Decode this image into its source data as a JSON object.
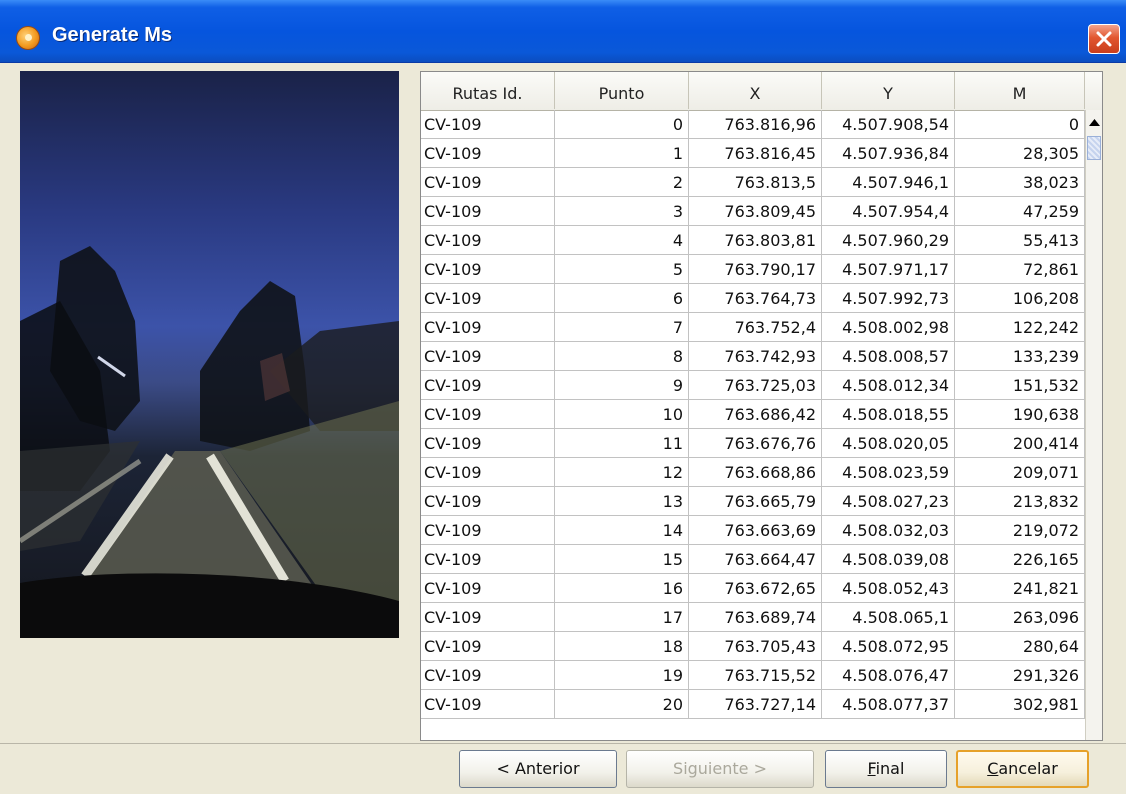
{
  "window": {
    "title": "Generate Ms"
  },
  "table": {
    "columns": [
      "Rutas Id.",
      "Punto",
      "X",
      "Y",
      "M"
    ],
    "rows": [
      [
        "CV-109",
        "0",
        "763.816,96",
        "4.507.908,54",
        "0"
      ],
      [
        "CV-109",
        "1",
        "763.816,45",
        "4.507.936,84",
        "28,305"
      ],
      [
        "CV-109",
        "2",
        "763.813,5",
        "4.507.946,1",
        "38,023"
      ],
      [
        "CV-109",
        "3",
        "763.809,45",
        "4.507.954,4",
        "47,259"
      ],
      [
        "CV-109",
        "4",
        "763.803,81",
        "4.507.960,29",
        "55,413"
      ],
      [
        "CV-109",
        "5",
        "763.790,17",
        "4.507.971,17",
        "72,861"
      ],
      [
        "CV-109",
        "6",
        "763.764,73",
        "4.507.992,73",
        "106,208"
      ],
      [
        "CV-109",
        "7",
        "763.752,4",
        "4.508.002,98",
        "122,242"
      ],
      [
        "CV-109",
        "8",
        "763.742,93",
        "4.508.008,57",
        "133,239"
      ],
      [
        "CV-109",
        "9",
        "763.725,03",
        "4.508.012,34",
        "151,532"
      ],
      [
        "CV-109",
        "10",
        "763.686,42",
        "4.508.018,55",
        "190,638"
      ],
      [
        "CV-109",
        "11",
        "763.676,76",
        "4.508.020,05",
        "200,414"
      ],
      [
        "CV-109",
        "12",
        "763.668,86",
        "4.508.023,59",
        "209,071"
      ],
      [
        "CV-109",
        "13",
        "763.665,79",
        "4.508.027,23",
        "213,832"
      ],
      [
        "CV-109",
        "14",
        "763.663,69",
        "4.508.032,03",
        "219,072"
      ],
      [
        "CV-109",
        "15",
        "763.664,47",
        "4.508.039,08",
        "226,165"
      ],
      [
        "CV-109",
        "16",
        "763.672,65",
        "4.508.052,43",
        "241,821"
      ],
      [
        "CV-109",
        "17",
        "763.689,74",
        "4.508.065,1",
        "263,096"
      ],
      [
        "CV-109",
        "18",
        "763.705,43",
        "4.508.072,95",
        "280,64"
      ],
      [
        "CV-109",
        "19",
        "763.715,52",
        "4.508.076,47",
        "291,326"
      ],
      [
        "CV-109",
        "20",
        "763.727,14",
        "4.508.077,37",
        "302,981"
      ]
    ]
  },
  "buttons": {
    "anterior": "< Anterior",
    "siguiente": "Siguiente >",
    "final": "Final",
    "cancelar": "Cancelar"
  },
  "icons": {
    "app": "app-logo-icon",
    "close": "close-icon",
    "scroll_up": "scroll-up-arrow-icon"
  },
  "colors": {
    "titlebar": "#0655de",
    "close_button": "#e25730",
    "dialog_background": "#ece9d8",
    "focused_button_border": "#e6a12a",
    "disabled_text": "#aaa89c"
  }
}
